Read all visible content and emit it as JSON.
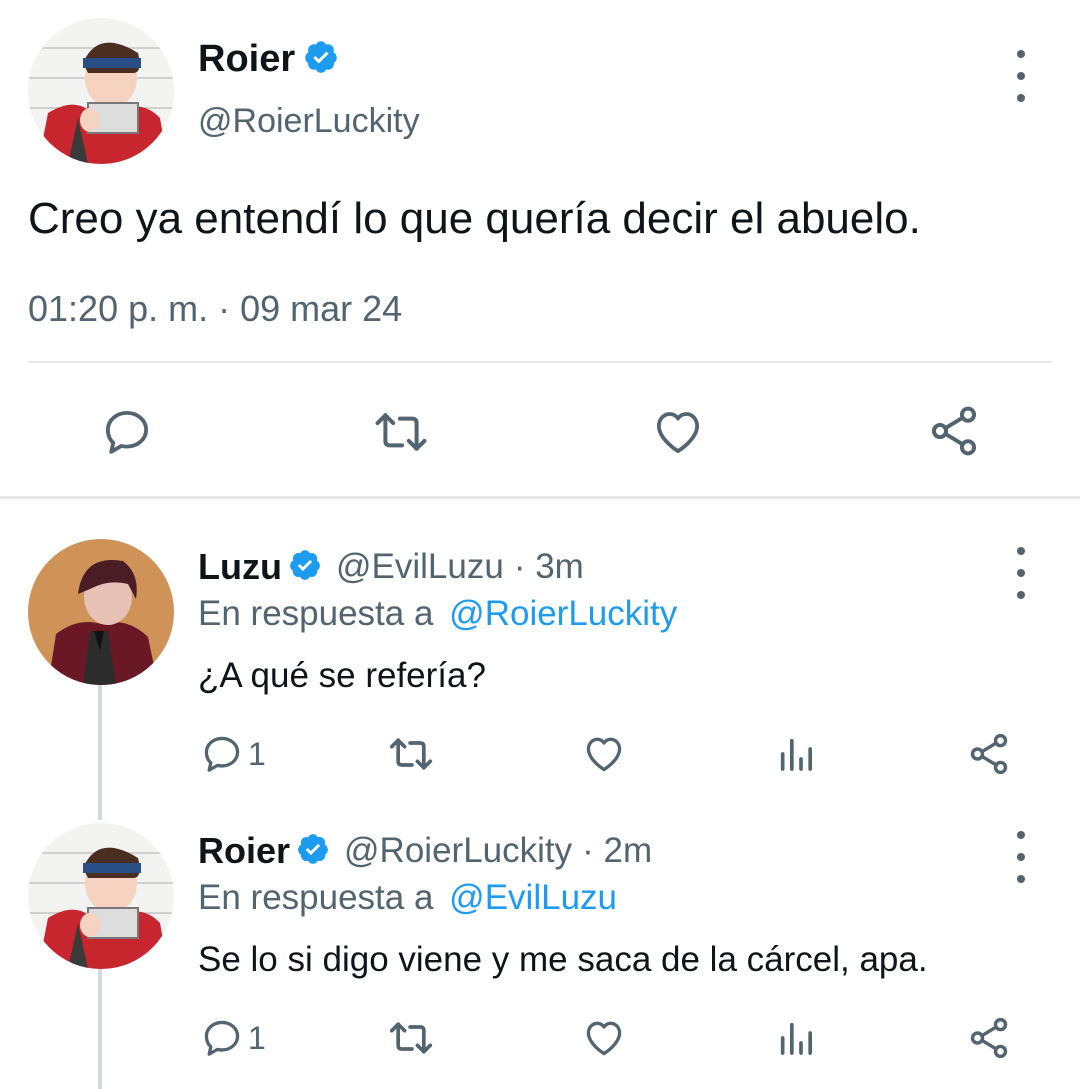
{
  "main_tweet": {
    "display_name": "Roier",
    "handle": "@RoierLuckity",
    "text": "Creo ya entendí lo que quería decir el abuelo.",
    "timestamp": "01:20 p. m. · 09 mar 24"
  },
  "replies": [
    {
      "display_name": "Luzu",
      "handle": "@EvilLuzu",
      "age": "· 3m",
      "reply_prefix": "En respuesta a",
      "reply_to": "@RoierLuckity",
      "text": "¿A qué se refería?",
      "reply_count": "1"
    },
    {
      "display_name": "Roier",
      "handle": "@RoierLuckity",
      "age": "· 2m",
      "reply_prefix": "En respuesta a",
      "reply_to": "@EvilLuzu",
      "text": "Se lo si digo viene y me saca de la cárcel, apa.",
      "reply_count": "1"
    }
  ],
  "colors": {
    "accent": "#1d9bf0",
    "text": "#0f1419",
    "muted": "#536471",
    "divider": "#e6e8ea"
  },
  "icons": [
    "verified-badge-icon",
    "more-vertical-icon",
    "reply-icon",
    "retweet-icon",
    "like-icon",
    "share-icon",
    "analytics-icon"
  ]
}
